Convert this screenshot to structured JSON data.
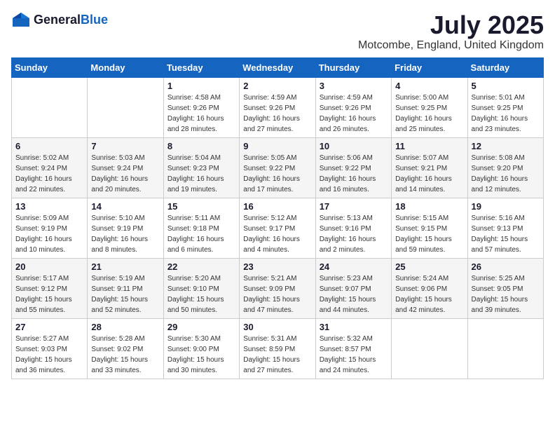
{
  "header": {
    "logo_general": "General",
    "logo_blue": "Blue",
    "title": "July 2025",
    "location": "Motcombe, England, United Kingdom"
  },
  "weekdays": [
    "Sunday",
    "Monday",
    "Tuesday",
    "Wednesday",
    "Thursday",
    "Friday",
    "Saturday"
  ],
  "weeks": [
    [
      {
        "day": "",
        "sunrise": "",
        "sunset": "",
        "daylight": ""
      },
      {
        "day": "",
        "sunrise": "",
        "sunset": "",
        "daylight": ""
      },
      {
        "day": "1",
        "sunrise": "Sunrise: 4:58 AM",
        "sunset": "Sunset: 9:26 PM",
        "daylight": "Daylight: 16 hours and 28 minutes."
      },
      {
        "day": "2",
        "sunrise": "Sunrise: 4:59 AM",
        "sunset": "Sunset: 9:26 PM",
        "daylight": "Daylight: 16 hours and 27 minutes."
      },
      {
        "day": "3",
        "sunrise": "Sunrise: 4:59 AM",
        "sunset": "Sunset: 9:26 PM",
        "daylight": "Daylight: 16 hours and 26 minutes."
      },
      {
        "day": "4",
        "sunrise": "Sunrise: 5:00 AM",
        "sunset": "Sunset: 9:25 PM",
        "daylight": "Daylight: 16 hours and 25 minutes."
      },
      {
        "day": "5",
        "sunrise": "Sunrise: 5:01 AM",
        "sunset": "Sunset: 9:25 PM",
        "daylight": "Daylight: 16 hours and 23 minutes."
      }
    ],
    [
      {
        "day": "6",
        "sunrise": "Sunrise: 5:02 AM",
        "sunset": "Sunset: 9:24 PM",
        "daylight": "Daylight: 16 hours and 22 minutes."
      },
      {
        "day": "7",
        "sunrise": "Sunrise: 5:03 AM",
        "sunset": "Sunset: 9:24 PM",
        "daylight": "Daylight: 16 hours and 20 minutes."
      },
      {
        "day": "8",
        "sunrise": "Sunrise: 5:04 AM",
        "sunset": "Sunset: 9:23 PM",
        "daylight": "Daylight: 16 hours and 19 minutes."
      },
      {
        "day": "9",
        "sunrise": "Sunrise: 5:05 AM",
        "sunset": "Sunset: 9:22 PM",
        "daylight": "Daylight: 16 hours and 17 minutes."
      },
      {
        "day": "10",
        "sunrise": "Sunrise: 5:06 AM",
        "sunset": "Sunset: 9:22 PM",
        "daylight": "Daylight: 16 hours and 16 minutes."
      },
      {
        "day": "11",
        "sunrise": "Sunrise: 5:07 AM",
        "sunset": "Sunset: 9:21 PM",
        "daylight": "Daylight: 16 hours and 14 minutes."
      },
      {
        "day": "12",
        "sunrise": "Sunrise: 5:08 AM",
        "sunset": "Sunset: 9:20 PM",
        "daylight": "Daylight: 16 hours and 12 minutes."
      }
    ],
    [
      {
        "day": "13",
        "sunrise": "Sunrise: 5:09 AM",
        "sunset": "Sunset: 9:19 PM",
        "daylight": "Daylight: 16 hours and 10 minutes."
      },
      {
        "day": "14",
        "sunrise": "Sunrise: 5:10 AM",
        "sunset": "Sunset: 9:19 PM",
        "daylight": "Daylight: 16 hours and 8 minutes."
      },
      {
        "day": "15",
        "sunrise": "Sunrise: 5:11 AM",
        "sunset": "Sunset: 9:18 PM",
        "daylight": "Daylight: 16 hours and 6 minutes."
      },
      {
        "day": "16",
        "sunrise": "Sunrise: 5:12 AM",
        "sunset": "Sunset: 9:17 PM",
        "daylight": "Daylight: 16 hours and 4 minutes."
      },
      {
        "day": "17",
        "sunrise": "Sunrise: 5:13 AM",
        "sunset": "Sunset: 9:16 PM",
        "daylight": "Daylight: 16 hours and 2 minutes."
      },
      {
        "day": "18",
        "sunrise": "Sunrise: 5:15 AM",
        "sunset": "Sunset: 9:15 PM",
        "daylight": "Daylight: 15 hours and 59 minutes."
      },
      {
        "day": "19",
        "sunrise": "Sunrise: 5:16 AM",
        "sunset": "Sunset: 9:13 PM",
        "daylight": "Daylight: 15 hours and 57 minutes."
      }
    ],
    [
      {
        "day": "20",
        "sunrise": "Sunrise: 5:17 AM",
        "sunset": "Sunset: 9:12 PM",
        "daylight": "Daylight: 15 hours and 55 minutes."
      },
      {
        "day": "21",
        "sunrise": "Sunrise: 5:19 AM",
        "sunset": "Sunset: 9:11 PM",
        "daylight": "Daylight: 15 hours and 52 minutes."
      },
      {
        "day": "22",
        "sunrise": "Sunrise: 5:20 AM",
        "sunset": "Sunset: 9:10 PM",
        "daylight": "Daylight: 15 hours and 50 minutes."
      },
      {
        "day": "23",
        "sunrise": "Sunrise: 5:21 AM",
        "sunset": "Sunset: 9:09 PM",
        "daylight": "Daylight: 15 hours and 47 minutes."
      },
      {
        "day": "24",
        "sunrise": "Sunrise: 5:23 AM",
        "sunset": "Sunset: 9:07 PM",
        "daylight": "Daylight: 15 hours and 44 minutes."
      },
      {
        "day": "25",
        "sunrise": "Sunrise: 5:24 AM",
        "sunset": "Sunset: 9:06 PM",
        "daylight": "Daylight: 15 hours and 42 minutes."
      },
      {
        "day": "26",
        "sunrise": "Sunrise: 5:25 AM",
        "sunset": "Sunset: 9:05 PM",
        "daylight": "Daylight: 15 hours and 39 minutes."
      }
    ],
    [
      {
        "day": "27",
        "sunrise": "Sunrise: 5:27 AM",
        "sunset": "Sunset: 9:03 PM",
        "daylight": "Daylight: 15 hours and 36 minutes."
      },
      {
        "day": "28",
        "sunrise": "Sunrise: 5:28 AM",
        "sunset": "Sunset: 9:02 PM",
        "daylight": "Daylight: 15 hours and 33 minutes."
      },
      {
        "day": "29",
        "sunrise": "Sunrise: 5:30 AM",
        "sunset": "Sunset: 9:00 PM",
        "daylight": "Daylight: 15 hours and 30 minutes."
      },
      {
        "day": "30",
        "sunrise": "Sunrise: 5:31 AM",
        "sunset": "Sunset: 8:59 PM",
        "daylight": "Daylight: 15 hours and 27 minutes."
      },
      {
        "day": "31",
        "sunrise": "Sunrise: 5:32 AM",
        "sunset": "Sunset: 8:57 PM",
        "daylight": "Daylight: 15 hours and 24 minutes."
      },
      {
        "day": "",
        "sunrise": "",
        "sunset": "",
        "daylight": ""
      },
      {
        "day": "",
        "sunrise": "",
        "sunset": "",
        "daylight": ""
      }
    ]
  ]
}
